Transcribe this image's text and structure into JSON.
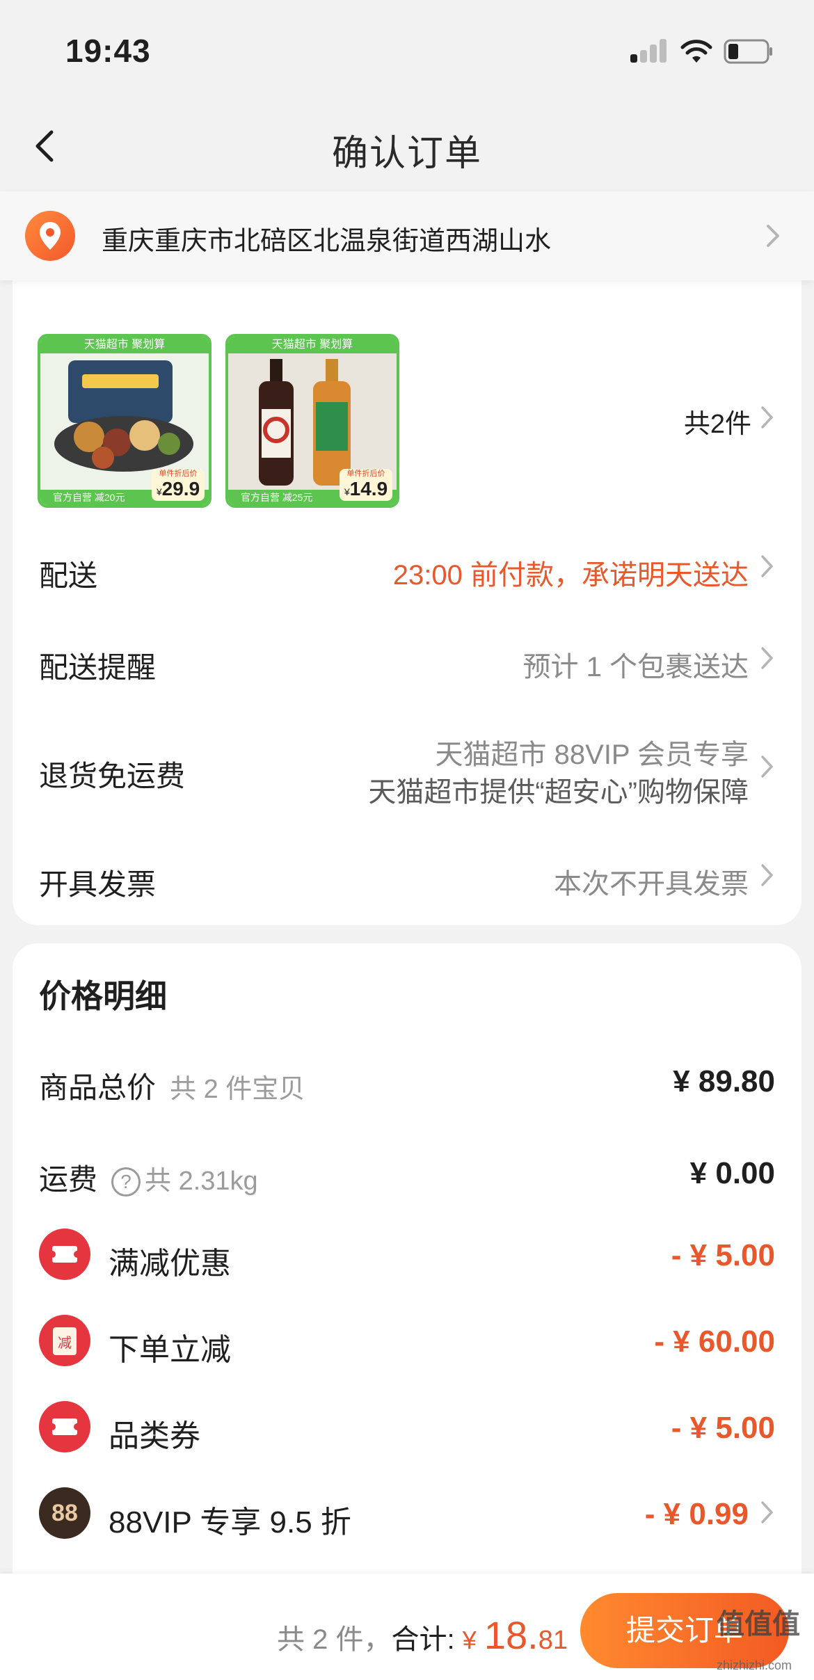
{
  "status_bar": {
    "time": "19:43"
  },
  "nav": {
    "title": "确认订单"
  },
  "address": {
    "text": "重庆重庆市北碚区北温泉街道西湖山水"
  },
  "order": {
    "products": [
      {
        "banner": "天猫超市 聚划算",
        "promo": "官方自营 减20元",
        "price_label": "单件折后价",
        "price": "29.9",
        "currency": "¥"
      },
      {
        "banner": "天猫超市 聚划算",
        "promo": "官方自营 减25元",
        "price_label": "单件折后价",
        "price": "14.9",
        "currency": "¥"
      }
    ],
    "count_label": "共2件",
    "rows": [
      {
        "label": "配送",
        "value": "23:00 前付款，承诺明天送达"
      },
      {
        "label": "配送提醒",
        "value": "预计 1 个包裹送达"
      },
      {
        "label": "退货免运费",
        "value_line1": "天猫超市 88VIP 会员专享",
        "value_line2": "天猫超市提供“超安心”购物保障"
      },
      {
        "label": "开具发票",
        "value": "本次不开具发票"
      }
    ]
  },
  "price_detail": {
    "title": "价格明细",
    "goods_total": {
      "label": "商品总价",
      "sub": "共 2 件宝贝",
      "value": "¥ 89.80"
    },
    "shipping": {
      "label": "运费",
      "sub": "共 2.31kg",
      "value": "¥ 0.00",
      "help_icon": "?"
    },
    "discounts": [
      {
        "label": "满减优惠",
        "value": "- ¥ 5.00"
      },
      {
        "label": "下单立减",
        "value": "- ¥ 60.00",
        "icon_text": "减"
      },
      {
        "label": "品类券",
        "value": "- ¥ 5.00"
      },
      {
        "label": "88VIP 专享 9.5 折",
        "value": "- ¥ 0.99",
        "icon_text": "88"
      }
    ]
  },
  "footer": {
    "count": "共 2 件，",
    "total_label": "合计:",
    "currency": "¥",
    "total_int": "18.",
    "total_dec": "81",
    "submit_label": "提交订单"
  },
  "watermark": {
    "logo": "值值值",
    "site": "zhizhizhi.com"
  },
  "colors": {
    "accent": "#e8582a",
    "green": "#5cc54f",
    "discount_red": "#e5363f"
  }
}
